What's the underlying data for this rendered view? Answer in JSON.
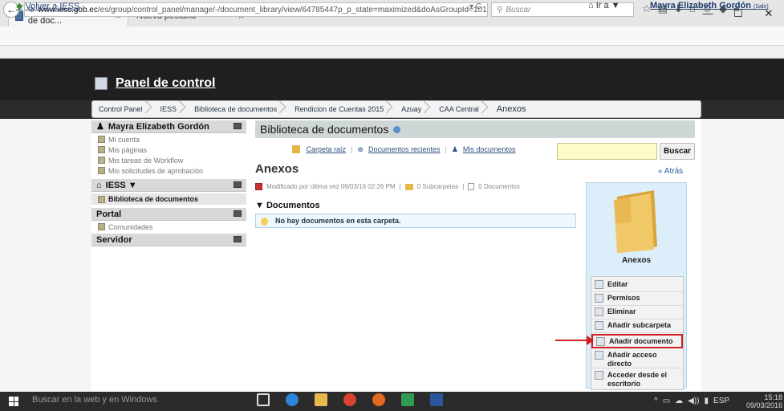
{
  "browser": {
    "tabs": [
      {
        "label": "Anexos - Biblioteca de doc...",
        "close": "×"
      },
      {
        "label": "Nueva pestaña",
        "close": "×"
      }
    ],
    "new_tab": "+",
    "window_controls": [
      "—",
      "☐",
      "✕"
    ],
    "url": "www.iess.gob.ec/es/group/control_panel/manage/-/document_library/view/64785447p_p_state=maximized&doAsGroupId=101",
    "url_domain": "www.iess.gob.ec",
    "url_path": "/es/group/control_panel/manage/-/document_library/view/64785447p_p_state=maximized&doAsGroupId=101",
    "url_right": "▾ C",
    "search_placeholder": "Buscar",
    "nav_icons": [
      "☆",
      "▤",
      "⬇",
      "⌂",
      "☺",
      "◆",
      "≡"
    ]
  },
  "dock": {
    "back_link": "Volver a IESS",
    "ira": "Ir a ▼",
    "user": "Mayra Elizabeth Gordón",
    "salir": "(Salir)"
  },
  "header": {
    "title": "Panel de control"
  },
  "breadcrumb": [
    "Control Panel",
    "IESS",
    "Biblioteca de documentos",
    "Rendicion de Cuentas 2015",
    "Azuay",
    "CAA Central",
    "Anexos"
  ],
  "sidebar": {
    "user_section": "Mayra Elizabeth Gordón",
    "user_items": [
      "Mi cuenta",
      "Mis páginas",
      "Mis tareas de Workflow",
      "Mis solicitudes de aprobación"
    ],
    "iess_section": "IESS ▼",
    "iess_items": [
      "Biblioteca de documentos"
    ],
    "portal_section": "Portal",
    "portal_items": [
      "Comunidades"
    ],
    "server_section": "Servidor"
  },
  "main": {
    "portlet_title": "Biblioteca de documentos",
    "links": [
      "Carpeta raíz",
      "Documentos recientes",
      "Mis documentos"
    ],
    "link_seps": [
      "|",
      "|"
    ],
    "search_button": "Buscar",
    "folder_title": "Anexos",
    "back": "« Atrás",
    "modified": "Modificado por última vez 09/03/16 02:26 PM",
    "subfolders": "0 Subcarpetas",
    "documents_count": "0 Documentos",
    "meta_seps": [
      "|",
      "|"
    ],
    "docs_heading": "Documentos",
    "docs_toggle": "▼",
    "empty_message": "No hay documentos en esta carpeta."
  },
  "card": {
    "title": "Anexos",
    "actions": [
      "Editar",
      "Permisos",
      "Eliminar",
      "Añadir subcarpeta",
      "Añadir documento",
      "Añadir acceso directo",
      "Acceder desde el escritorio"
    ]
  },
  "taskbar": {
    "search": "Buscar en la web y en Windows",
    "tray": [
      "^",
      "▭",
      "☁",
      "◀))",
      "▮",
      "ESP"
    ],
    "time": "15:18",
    "date": "09/03/2016"
  },
  "colors": {
    "highlight": "#d12020",
    "dark_header": "#1f1f1f",
    "link": "#2f4f7f"
  }
}
